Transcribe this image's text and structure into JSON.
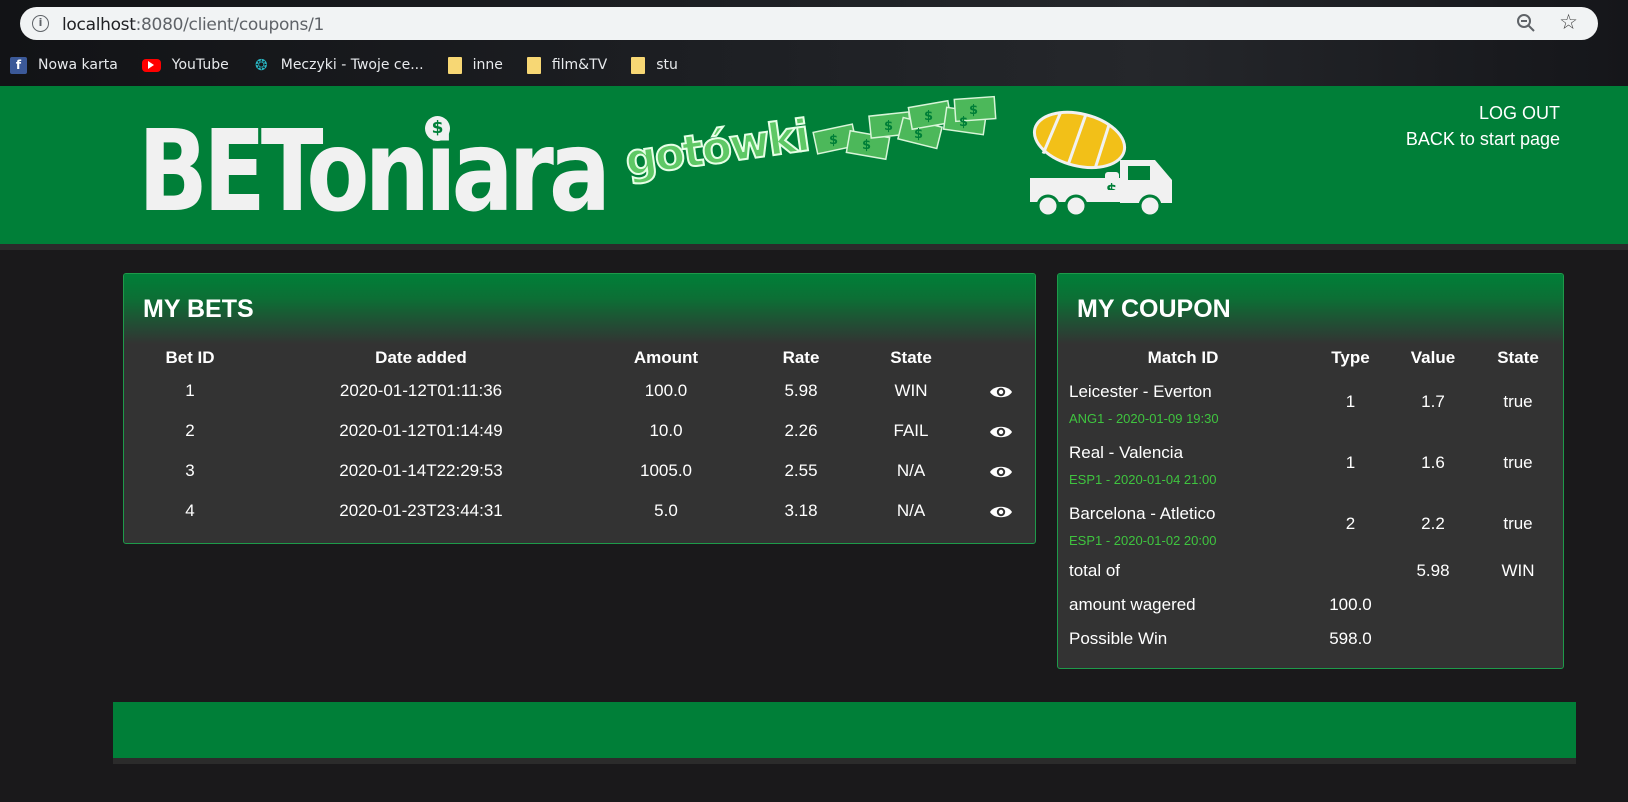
{
  "browser": {
    "url_host": "localhost",
    "url_rest": ":8080/client/coupons/1",
    "bookmarks": [
      {
        "label": "Nowa karta",
        "icon": "facebook-icon"
      },
      {
        "label": "YouTube",
        "icon": "youtube-icon"
      },
      {
        "label": "Meczyki - Twoje ce...",
        "icon": "meczyki-icon"
      },
      {
        "label": "inne",
        "icon": "folder-icon"
      },
      {
        "label": "film&TV",
        "icon": "folder-icon"
      },
      {
        "label": "stu",
        "icon": "folder-icon"
      }
    ]
  },
  "header": {
    "logo_text": "BEToniara",
    "logo_coin": "$",
    "tagline": "gotówki",
    "logout": "LOG OUT",
    "back": "BACK to start page",
    "brand_color": "#007f38"
  },
  "bets": {
    "title": "MY BETS",
    "columns": [
      "Bet ID",
      "Date added",
      "Amount",
      "Rate",
      "State"
    ],
    "rows": [
      {
        "id": "1",
        "date": "2020-01-12T01:11:36",
        "amount": "100.0",
        "rate": "5.98",
        "state": "WIN"
      },
      {
        "id": "2",
        "date": "2020-01-12T01:14:49",
        "amount": "10.0",
        "rate": "2.26",
        "state": "FAIL"
      },
      {
        "id": "3",
        "date": "2020-01-14T22:29:53",
        "amount": "1005.0",
        "rate": "2.55",
        "state": "N/A"
      },
      {
        "id": "4",
        "date": "2020-01-23T23:44:31",
        "amount": "5.0",
        "rate": "3.18",
        "state": "N/A"
      }
    ]
  },
  "coupon": {
    "title": "MY COUPON",
    "columns": [
      "Match ID",
      "Type",
      "Value",
      "State"
    ],
    "rows": [
      {
        "match": "Leicester - Everton",
        "info": "ANG1 - 2020-01-09 19:30",
        "type": "1",
        "value": "1.7",
        "state": "true"
      },
      {
        "match": "Real - Valencia",
        "info": "ESP1 - 2020-01-04 21:00",
        "type": "1",
        "value": "1.6",
        "state": "true"
      },
      {
        "match": "Barcelona - Atletico",
        "info": "ESP1 - 2020-01-02 20:00",
        "type": "2",
        "value": "2.2",
        "state": "true"
      }
    ],
    "total_label": "total of",
    "total_value": "5.98",
    "total_state": "WIN",
    "wagered_label": "amount wagered",
    "wagered_value": "100.0",
    "win_label": "Possible Win",
    "win_value": "598.0"
  }
}
